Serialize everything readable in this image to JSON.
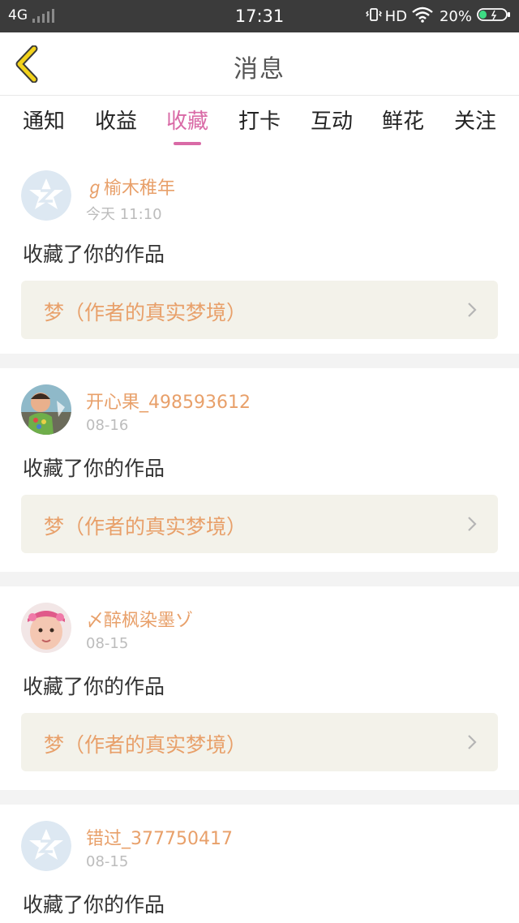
{
  "status_bar": {
    "network": "4G",
    "time": "17:31",
    "hd": "HD",
    "battery": "20%"
  },
  "header": {
    "title": "消息"
  },
  "tabs": [
    {
      "label": "通知"
    },
    {
      "label": "收益"
    },
    {
      "label": "收藏",
      "active": true
    },
    {
      "label": "打卡"
    },
    {
      "label": "互动"
    },
    {
      "label": "鲜花"
    },
    {
      "label": "关注"
    }
  ],
  "messages": [
    {
      "username": "ℊ榆木稚年",
      "time": "今天 11:10",
      "action": "收藏了你的作品",
      "work_title": "梦（作者的真实梦境）",
      "avatar": "default-q-avatar"
    },
    {
      "username": "开心果_498593612",
      "time": "08-16",
      "action": "收藏了你的作品",
      "work_title": "梦（作者的真实梦境）",
      "avatar": "photo-avatar-child"
    },
    {
      "username": "〆醉枫染墨ゾ",
      "time": "08-15",
      "action": "收藏了你的作品",
      "work_title": "梦（作者的真实梦境）",
      "avatar": "photo-avatar-baby"
    },
    {
      "username": "错过_377750417",
      "time": "08-15",
      "action": "收藏了你的作品",
      "avatar": "default-q-avatar"
    }
  ],
  "colors": {
    "accent_pink": "#d96aa6",
    "username_orange": "#e8a06a",
    "back_arrow_yellow": "#f2d21b"
  }
}
